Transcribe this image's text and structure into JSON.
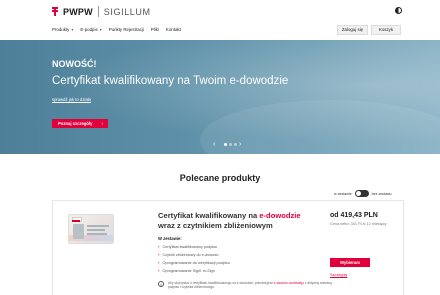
{
  "colors": {
    "brand": "#e2003a",
    "hero_bg": "#5d90a8",
    "text": "#222222"
  },
  "header": {
    "logo_text": "PWPW",
    "logo_sub": "SIGILLUM",
    "nav": [
      {
        "label": "Produkty",
        "has_dropdown": true
      },
      {
        "label": "E-podpis",
        "has_dropdown": true
      },
      {
        "label": "Punkty Rejestracji",
        "has_dropdown": false
      },
      {
        "label": "Pliki",
        "has_dropdown": false
      },
      {
        "label": "Kontakt",
        "has_dropdown": false
      }
    ],
    "login_label": "Zaloguj się",
    "cart_label": "Koszyk",
    "contrast_icon": "contrast-icon"
  },
  "hero": {
    "badge": "NOWOŚĆ!",
    "title": "Certyfikat kwalifikowany na Twoim e-dowodzie",
    "link": "sprawdź jak to działa",
    "cta": "Poznaj szczegóły",
    "slider_prev": "‹",
    "slider_next": "›",
    "slides": 3,
    "active_slide": 1
  },
  "section": {
    "title": "Polecane produkty",
    "toggle_left": "w zestawie",
    "toggle_right": "bez zestawu"
  },
  "product": {
    "title_before": "Certyfikat kwalifikowany na ",
    "title_highlight": "e-dowodzie",
    "title_after": " wraz z czytnikiem zbliżeniowym",
    "includes_label": "W zestawie:",
    "features": [
      "Certyfikat kwalifikowany podpisu",
      "Czytnik zbliżeniowy do e-dowodu",
      "Oprogramowanie do weryfikacji podpisu",
      "Oprogramowanie Sigill. m-Sign"
    ],
    "info_before": "Aby skorzystać z certyfikatu kwalifikowanego na e-dowodzie, potrzebujesz ",
    "info_highlight": "e-dowodu osobistego",
    "info_after": " z aktywną warstwą podpisu i czytnika zbliżeniowego.",
    "price": "od 419,43 PLN",
    "price_sub": "Cena netto: 341 PLN 12 miesięcy",
    "buy_label": "Wybieram",
    "details_label": "Szczegóły"
  }
}
